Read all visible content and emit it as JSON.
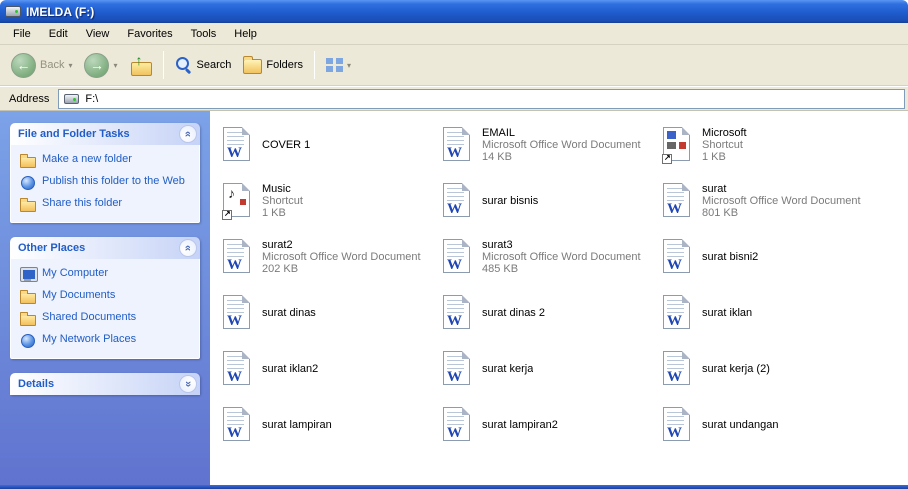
{
  "titlebar": {
    "title": "IMELDA (F:)"
  },
  "menu": {
    "items": [
      {
        "label": "File"
      },
      {
        "label": "Edit"
      },
      {
        "label": "View"
      },
      {
        "label": "Favorites"
      },
      {
        "label": "Tools"
      },
      {
        "label": "Help"
      }
    ]
  },
  "toolbar": {
    "back_label": "Back",
    "search_label": "Search",
    "folders_label": "Folders"
  },
  "address": {
    "label": "Address",
    "value": "F:\\"
  },
  "sidebar": {
    "panels": [
      {
        "title": "File and Folder Tasks",
        "items": [
          {
            "label": "Make a new folder",
            "icon": "new-folder"
          },
          {
            "label": "Publish this folder to the Web",
            "icon": "publish-web"
          },
          {
            "label": "Share this folder",
            "icon": "share-folder"
          }
        ]
      },
      {
        "title": "Other Places",
        "items": [
          {
            "label": "My Computer",
            "icon": "my-computer"
          },
          {
            "label": "My Documents",
            "icon": "my-documents"
          },
          {
            "label": "Shared Documents",
            "icon": "shared-documents"
          },
          {
            "label": "My Network Places",
            "icon": "network-places"
          }
        ]
      },
      {
        "title": "Details",
        "items": []
      }
    ]
  },
  "files": [
    {
      "name": "COVER 1",
      "type": "",
      "size": "",
      "icon": "word"
    },
    {
      "name": "EMAIL",
      "type": "Microsoft Office Word Document",
      "size": "14 KB",
      "icon": "word"
    },
    {
      "name": "Microsoft",
      "type": "Shortcut",
      "size": "1 KB",
      "icon": "shortcut-office"
    },
    {
      "name": "Music",
      "type": "Shortcut",
      "size": "1 KB",
      "icon": "shortcut-music"
    },
    {
      "name": "surar bisnis",
      "type": "",
      "size": "",
      "icon": "word"
    },
    {
      "name": "surat",
      "type": "Microsoft Office Word Document",
      "size": "801 KB",
      "icon": "word"
    },
    {
      "name": "surat2",
      "type": "Microsoft Office Word Document",
      "size": "202 KB",
      "icon": "word"
    },
    {
      "name": "surat3",
      "type": "Microsoft Office Word Document",
      "size": "485 KB",
      "icon": "word"
    },
    {
      "name": "surat bisni2",
      "type": "",
      "size": "",
      "icon": "word"
    },
    {
      "name": "surat dinas",
      "type": "",
      "size": "",
      "icon": "word"
    },
    {
      "name": "surat dinas 2",
      "type": "",
      "size": "",
      "icon": "word"
    },
    {
      "name": "surat iklan",
      "type": "",
      "size": "",
      "icon": "word"
    },
    {
      "name": "surat iklan2",
      "type": "",
      "size": "",
      "icon": "word"
    },
    {
      "name": "surat kerja",
      "type": "",
      "size": "",
      "icon": "word"
    },
    {
      "name": "surat kerja (2)",
      "type": "",
      "size": "",
      "icon": "word"
    },
    {
      "name": "surat lampiran",
      "type": "",
      "size": "",
      "icon": "word"
    },
    {
      "name": "surat lampiran2",
      "type": "",
      "size": "",
      "icon": "word"
    },
    {
      "name": "surat undangan",
      "type": "",
      "size": "",
      "icon": "word"
    }
  ]
}
